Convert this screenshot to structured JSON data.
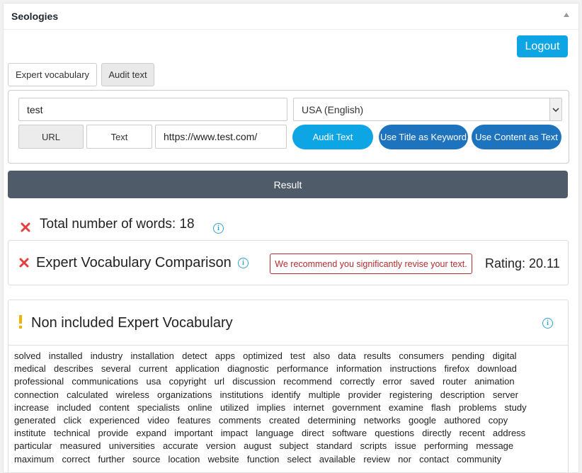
{
  "panel": {
    "title": "Seologies"
  },
  "header": {
    "logout_label": "Logout"
  },
  "tabs": [
    {
      "label": "Expert vocabulary"
    },
    {
      "label": "Audit text"
    }
  ],
  "form": {
    "keyword_value": "test",
    "language_selected": "USA (English)",
    "source_buttons": [
      "URL",
      "Text"
    ],
    "url_value": "https://www.test.com/",
    "audit_button": "Audit Text",
    "title_keyword_button": "Use Title as Keyword",
    "content_text_button": "Use Content as Text"
  },
  "result": {
    "label": "Result"
  },
  "total_words": {
    "label": "Total number of words: 18"
  },
  "expert_comparison": {
    "title": "Expert Vocabulary Comparison",
    "note": "We recommend you significantly revise your text.",
    "rating": "Rating: 20.11"
  },
  "non_included": {
    "title": "Non included Expert Vocabulary",
    "lines": [
      "solved  installed  industry  installation  detect  apps  optimized  test  also  data  results  consumers  pending  digital",
      "medical  describes  several  current  application  diagnostic  performance  information  instructions  firefox  download",
      "professional  communications  usa  copyright  url  discussion  recommend  correctly  error  saved  router  animation",
      "connection  calculated  wireless  organizations  institutions  identify  multiple  provider  registering  description  server",
      "increase  included  content  specialists  online  utilized  implies  internet  government  examine  flash  problems  study",
      "generated  click  experienced  video  features  comments  created  determining  networks  google  authored  copy",
      "institute  technical  provide  expand  important  impact  language  direct  software  questions  directly  recent  address",
      "particular  measured  universities  accurate  version  august  subject  standard  scripts  issue  performing  message",
      "maximum  correct  further  source  location  website  function  select  available  review  nor  contact  community"
    ]
  },
  "colors": {
    "accent": "#0ea5e5",
    "secondary_button": "#1e73be",
    "result_bar": "#4f5b68",
    "error_red": "#e53e3e",
    "warning_yellow": "#f0b400",
    "info_blue": "#2ea2cc"
  }
}
